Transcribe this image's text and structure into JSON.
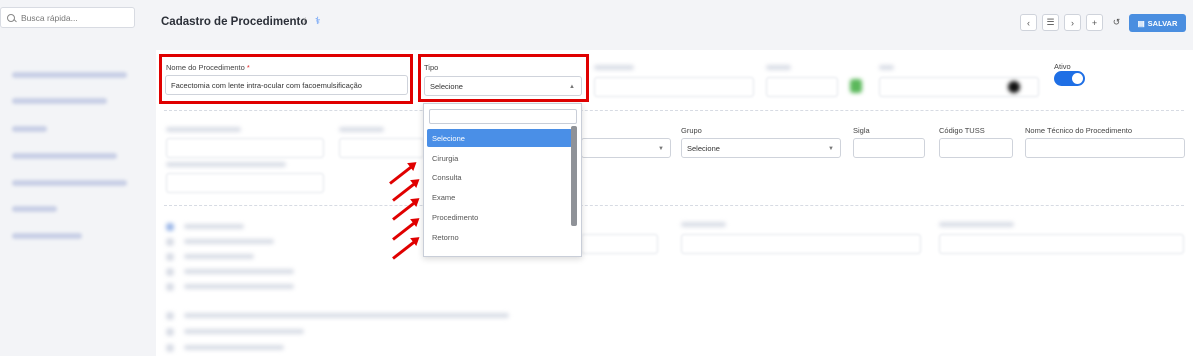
{
  "search": {
    "placeholder": "Busca rápida..."
  },
  "header": {
    "title": "Cadastro de Procedimento",
    "separator": "/",
    "save_label": "SALVAR"
  },
  "form": {
    "nome_label": "Nome do Procedimento",
    "nome_required": "*",
    "nome_value": "Facectomia com lente intra-ocular com facoemulsificação",
    "tipo_label": "Tipo",
    "tipo_value": "Selecione",
    "ativo_label": "Ativo",
    "grupo_label": "Grupo",
    "grupo_value": "Selecione",
    "sigla_label": "Sigla",
    "tuss_label": "Código TUSS",
    "nome_tecnico_label": "Nome Técnico do Procedimento"
  },
  "dropdown": {
    "options": [
      "Selecione",
      "Cirurgia",
      "Consulta",
      "Exame",
      "Procedimento",
      "Retorno"
    ],
    "selected_index": 0
  },
  "colors": {
    "accent": "#4a8ee0",
    "highlight": "#e00000",
    "toggle_on": "#1f6fe5"
  },
  "icons": [
    "search-icon",
    "stethoscope-icon",
    "chevron-left-icon",
    "list-icon",
    "chevron-right-icon",
    "plus-icon",
    "history-icon",
    "save-icon"
  ]
}
